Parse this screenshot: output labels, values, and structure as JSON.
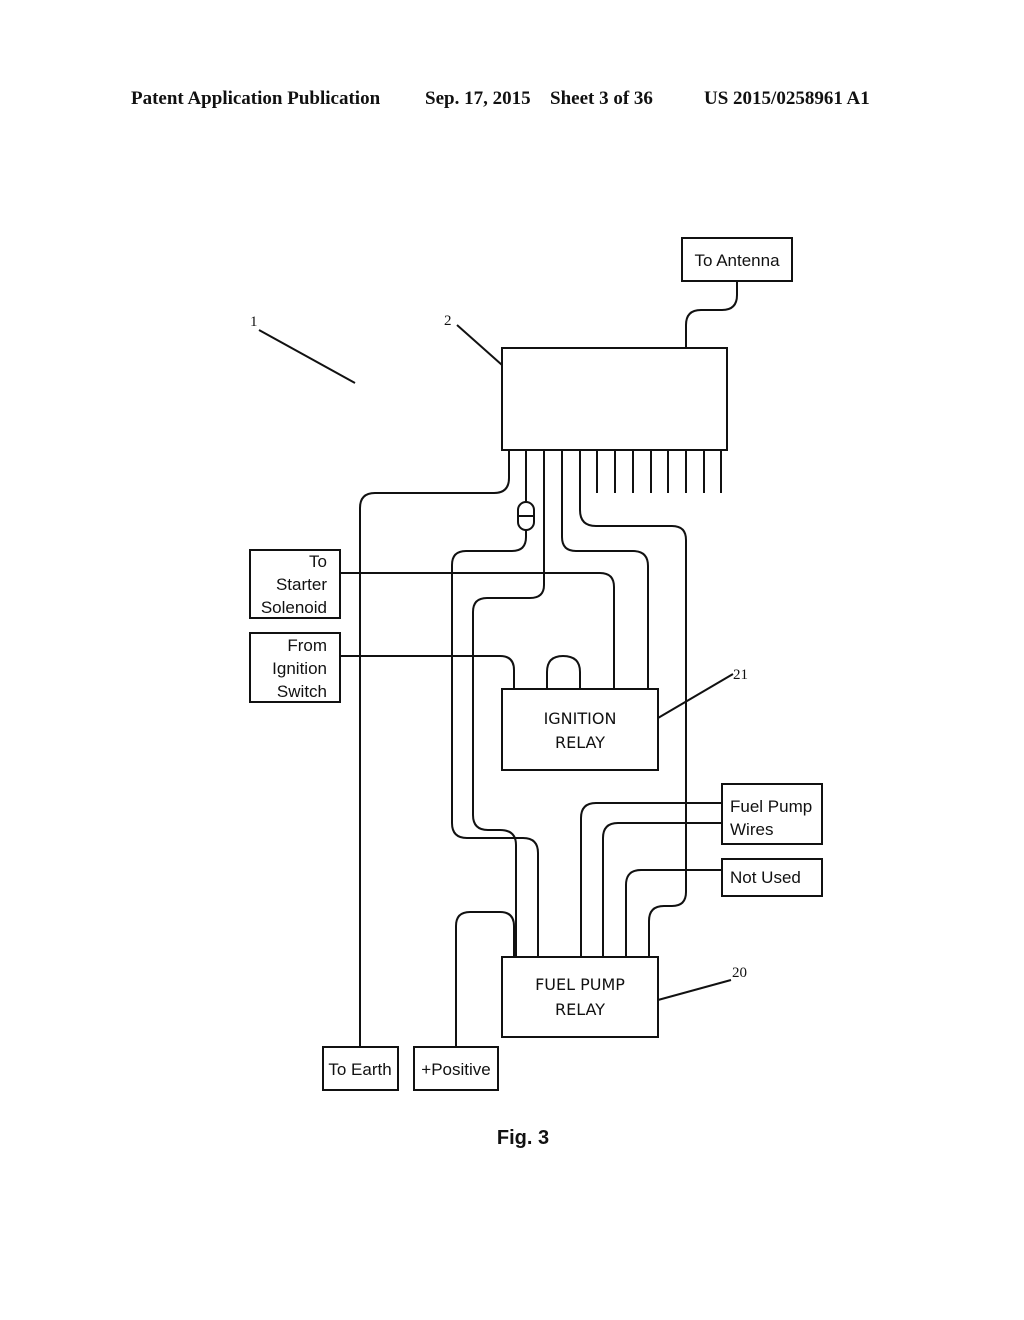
{
  "header": {
    "publication": "Patent Application Publication",
    "date": "Sep. 17, 2015",
    "sheet": "Sheet 3 of 36",
    "patent_number": "US 2015/0258961 A1"
  },
  "diagram": {
    "reference_numerals": {
      "system": "1",
      "controller": "2",
      "ignition_relay": "21",
      "fuel_pump_relay": "20"
    },
    "boxes": {
      "antenna": [
        "To Antenna"
      ],
      "starter": [
        "To",
        "Starter",
        "Solenoid"
      ],
      "ignition_switch": [
        "From",
        "Ignition",
        "Switch"
      ],
      "ignition_relay": [
        "IGNITION",
        "RELAY"
      ],
      "fuel_pump_wires": [
        "Fuel Pump",
        "Wires"
      ],
      "not_used": [
        "Not Used"
      ],
      "fuel_pump_relay": [
        "FUEL PUMP",
        "RELAY"
      ],
      "earth": [
        "To Earth"
      ],
      "positive": [
        "+Positive"
      ]
    },
    "figure_caption": "Fig. 3"
  }
}
